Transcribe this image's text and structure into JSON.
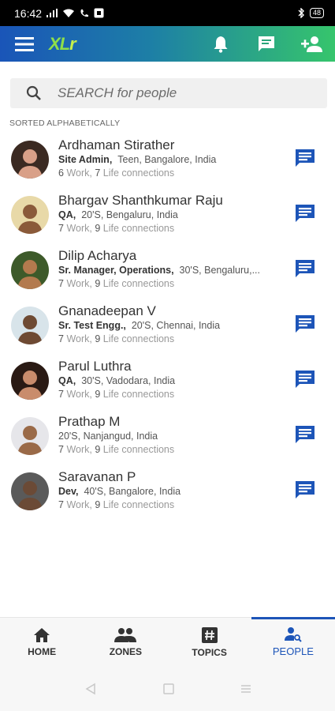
{
  "status_bar": {
    "time": "16:42",
    "battery": "48"
  },
  "app_bar": {
    "logo_main": "XL",
    "logo_accent": "r"
  },
  "search": {
    "placeholder": "SEARCH for people"
  },
  "sort_label": "SORTED ALPHABETICALLY",
  "people": [
    {
      "name": "Ardhaman Stirather",
      "role": "Site Admin,",
      "details": "Teen, Bangalore, India",
      "work": "6",
      "life": "7",
      "work_label": "Work,",
      "life_label": "Life connections",
      "avatar_bg": "#3b2a22",
      "avatar_face": "#d9a088"
    },
    {
      "name": "Bhargav Shanthkumar Raju",
      "role": "QA,",
      "details": "20'S, Bengaluru, India",
      "work": "7",
      "life": "9",
      "work_label": "Work,",
      "life_label": "Life connections",
      "avatar_bg": "#e8d9a8",
      "avatar_face": "#8a5a3a"
    },
    {
      "name": "Dilip Acharya",
      "role": "Sr. Manager, Operations,",
      "details": "30'S, Bengaluru,...",
      "work": "7",
      "life": "9",
      "work_label": "Work,",
      "life_label": "Life connections",
      "avatar_bg": "#3d5a2a",
      "avatar_face": "#b37a4e"
    },
    {
      "name": "Gnanadeepan V",
      "role": "Sr. Test Engg.,",
      "details": "20'S, Chennai, India",
      "work": "7",
      "life": "9",
      "work_label": "Work,",
      "life_label": "Life connections",
      "avatar_bg": "#d8e4ea",
      "avatar_face": "#6e4a33"
    },
    {
      "name": "Parul Luthra",
      "role": "QA,",
      "details": "30'S, Vadodara, India",
      "work": "7",
      "life": "9",
      "work_label": "Work,",
      "life_label": "Life connections",
      "avatar_bg": "#2a1a14",
      "avatar_face": "#c98c6c"
    },
    {
      "name": "Prathap M",
      "role": "",
      "details": "20'S, Nanjangud, India",
      "work": "7",
      "life": "9",
      "work_label": "Work,",
      "life_label": "Life connections",
      "avatar_bg": "#e6e6ea",
      "avatar_face": "#9a6a48"
    },
    {
      "name": "Saravanan P",
      "role": "Dev,",
      "details": "40'S, Bangalore, India",
      "work": "7",
      "life": "9",
      "work_label": "Work,",
      "life_label": "Life connections",
      "avatar_bg": "#5a5a5a",
      "avatar_face": "#6b4a36"
    }
  ],
  "bottom_nav": [
    {
      "label": "HOME",
      "icon": "home-icon"
    },
    {
      "label": "ZONES",
      "icon": "group-icon"
    },
    {
      "label": "TOPICS",
      "icon": "hashtag-icon"
    },
    {
      "label": "PEOPLE",
      "icon": "person-search-icon",
      "active": true
    }
  ],
  "colors": {
    "accent": "#1d55b8",
    "chat_icon": "#1d55b8",
    "gradient_start": "#1a55b8",
    "gradient_end": "#36c56c"
  }
}
